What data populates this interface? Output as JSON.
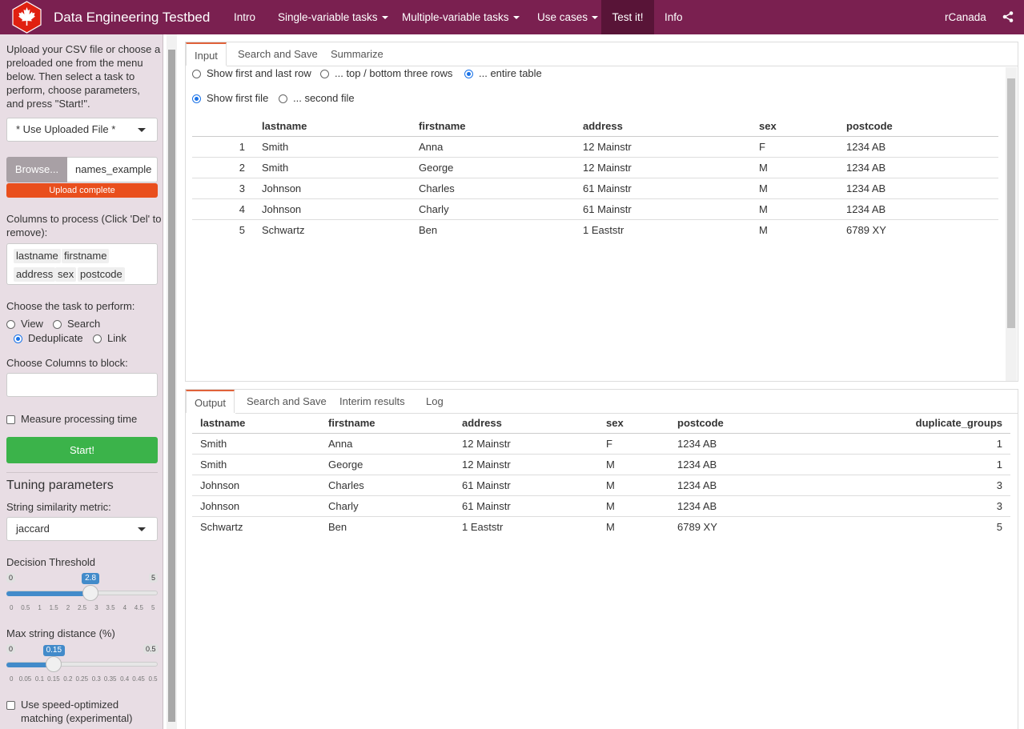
{
  "navbar": {
    "brand": "Data Engineering Testbed",
    "items": [
      {
        "label": "Intro"
      },
      {
        "label": "Single-variable tasks"
      },
      {
        "label": "Multiple-variable tasks"
      },
      {
        "label": "Use cases"
      },
      {
        "label": "Test it!"
      },
      {
        "label": "Info"
      }
    ],
    "right_label": "rCanada",
    "colors": {
      "bar": "#7a2050",
      "active": "#581437"
    }
  },
  "sidebar": {
    "intro": [
      "Upload your CSV file or choose a",
      "preloaded one from the menu",
      "below. Then select a task to",
      "perform, choose parameters,",
      "and press \"Start!\"."
    ],
    "file_select": "* Use Uploaded File *",
    "browse_label": "Browse...",
    "file_name": "names_example",
    "upload_status": "Upload complete",
    "columns_label": [
      "Columns to process (Click 'Del' to",
      "remove):"
    ],
    "columns": [
      "lastname",
      "firstname",
      "address",
      "sex",
      "postcode"
    ],
    "task_label": "Choose the task to perform:",
    "tasks": [
      {
        "label": "View",
        "selected": false
      },
      {
        "label": "Search",
        "selected": false
      },
      {
        "label": "Deduplicate",
        "selected": true
      },
      {
        "label": "Link",
        "selected": false
      }
    ],
    "block_label": "Choose Columns to block:",
    "measure_label": "Measure processing time",
    "start_label": "Start!",
    "tuning_title": "Tuning parameters",
    "metric_label": "String similarity metric:",
    "metric_value": "jaccard",
    "threshold": {
      "label": "Decision Threshold",
      "min": "0",
      "max": "5",
      "value": "2.8",
      "fraction": 0.56,
      "ticks": [
        "0",
        "0.5",
        "1",
        "1.5",
        "2",
        "2.5",
        "3",
        "3.5",
        "4",
        "4.5",
        "5"
      ]
    },
    "max_dist": {
      "label": "Max string distance (%)",
      "min": "0",
      "max": "0.5",
      "value": "0.15",
      "fraction": 0.3,
      "ticks": [
        "0",
        "0.05",
        "0.1",
        "0.15",
        "0.2",
        "0.25",
        "0.3",
        "0.35",
        "0.4",
        "0.45",
        "0.5"
      ]
    },
    "speed_label": [
      "Use speed-optimized",
      "matching (experimental)"
    ]
  },
  "input_panel": {
    "tabs": [
      "Input",
      "Search and Save",
      "Summarize"
    ],
    "row_options": [
      {
        "label": "Show first and last row",
        "selected": false
      },
      {
        "label": "... top / bottom three rows",
        "selected": false
      },
      {
        "label": "... entire table",
        "selected": true
      }
    ],
    "file_options": [
      {
        "label": "Show first file",
        "selected": true
      },
      {
        "label": "... second file",
        "selected": false
      }
    ],
    "columns": [
      "lastname",
      "firstname",
      "address",
      "sex",
      "postcode"
    ],
    "rows": [
      [
        "1",
        "Smith",
        "Anna",
        "12 Mainstr",
        "F",
        "1234 AB"
      ],
      [
        "2",
        "Smith",
        "George",
        "12 Mainstr",
        "M",
        "1234 AB"
      ],
      [
        "3",
        "Johnson",
        "Charles",
        "61 Mainstr",
        "M",
        "1234 AB"
      ],
      [
        "4",
        "Johnson",
        "Charly",
        "61 Mainstr",
        "M",
        "1234 AB"
      ],
      [
        "5",
        "Schwartz",
        "Ben",
        "1 Eaststr",
        "M",
        "6789 XY"
      ]
    ]
  },
  "output_panel": {
    "tabs": [
      "Output",
      "Search and Save",
      "Interim results",
      "Log"
    ],
    "columns": [
      "lastname",
      "firstname",
      "address",
      "sex",
      "postcode",
      "duplicate_groups"
    ],
    "rows": [
      [
        "Smith",
        "Anna",
        "12 Mainstr",
        "F",
        "1234 AB",
        "1"
      ],
      [
        "Smith",
        "George",
        "12 Mainstr",
        "M",
        "1234 AB",
        "1"
      ],
      [
        "Johnson",
        "Charles",
        "61 Mainstr",
        "M",
        "1234 AB",
        "3"
      ],
      [
        "Johnson",
        "Charly",
        "61 Mainstr",
        "M",
        "1234 AB",
        "3"
      ],
      [
        "Schwartz",
        "Ben",
        "1 Eaststr",
        "M",
        "6789 XY",
        "5"
      ]
    ]
  }
}
